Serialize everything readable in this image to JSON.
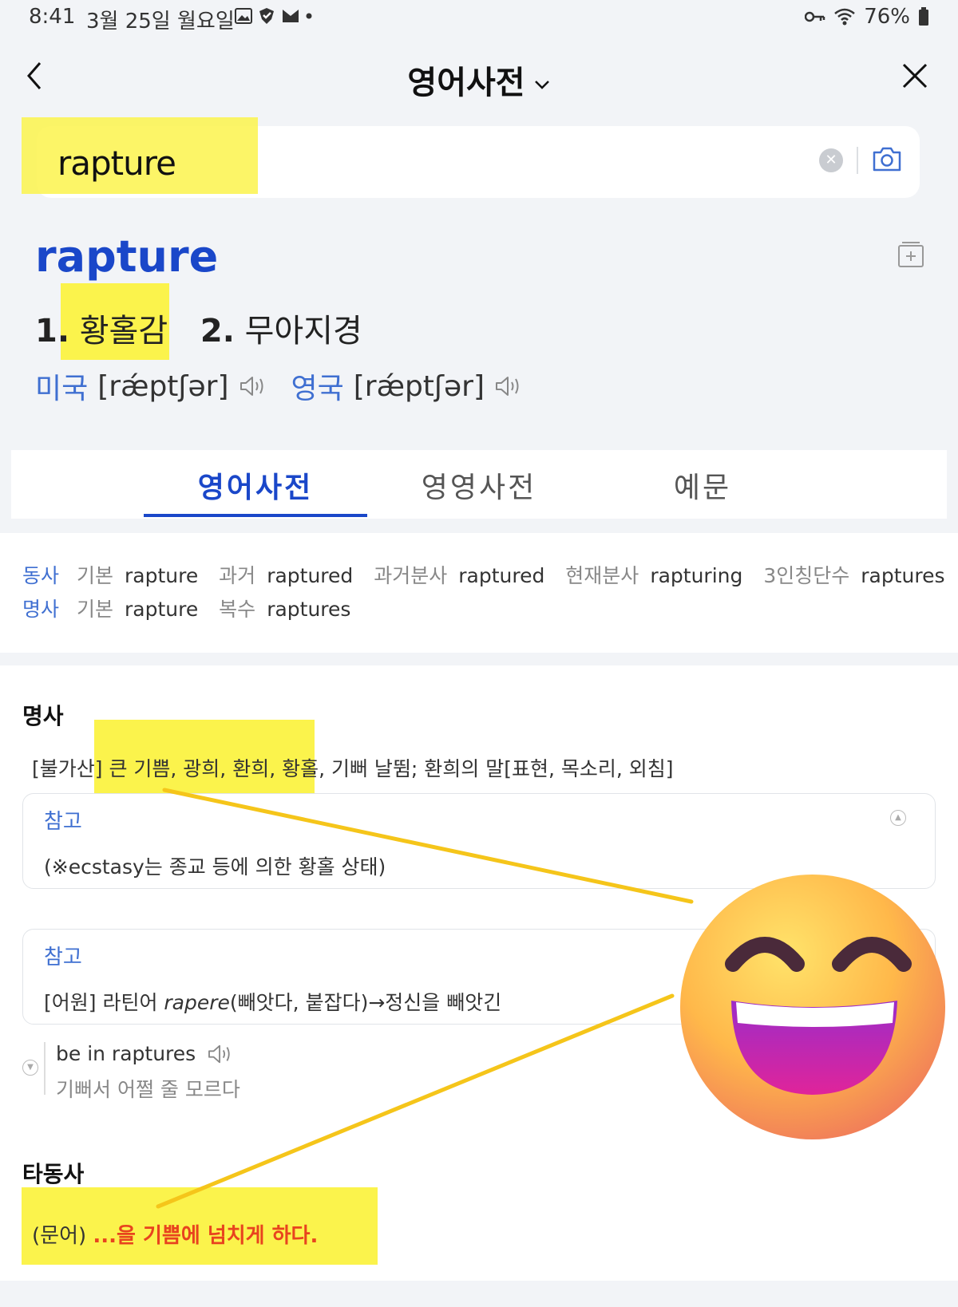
{
  "status": {
    "time": "8:41",
    "date": "3월 25일 월요일",
    "battery": "76%"
  },
  "header": {
    "title": "영어사전"
  },
  "search": {
    "query": "rapture"
  },
  "entry": {
    "headword": "rapture",
    "meaning1_num": "1.",
    "meaning1": "황홀감",
    "meaning2_num": "2.",
    "meaning2": "무아지경",
    "us_label": "미국",
    "us_ipa": "[rǽptʃər]",
    "uk_label": "영국",
    "uk_ipa": "[rǽptʃər]"
  },
  "tabs": {
    "t1": "영어사전",
    "t2": "영영사전",
    "t3": "예문"
  },
  "forms": {
    "verb": {
      "pos": "동사",
      "base_label": "기본",
      "base": "rapture",
      "past_label": "과거",
      "past": "raptured",
      "pp_label": "과거분사",
      "pp": "raptured",
      "ing_label": "현재분사",
      "ing": "rapturing",
      "s_label": "3인칭단수",
      "s": "raptures"
    },
    "noun": {
      "pos": "명사",
      "base_label": "기본",
      "base": "rapture",
      "pl_label": "복수",
      "pl": "raptures"
    }
  },
  "noun_section": {
    "title": "명사",
    "definition": "[불가산] 큰 기쁨, 광희, 환희, 황홀, 기뻐 날뜀; 환희의 말[표현, 목소리, 외침]",
    "note1_title": "참고",
    "note1_text": "(※ecstasy는 종교 등에 의한 황홀 상태)",
    "note2_title": "참고",
    "note2_pre": "[어원] 라틴어 ",
    "note2_italic": "rapere",
    "note2_post": "(빼앗다, 붙잡다)→정신을 빼앗긴",
    "idiom_en": "be in raptures",
    "idiom_ko": "기뻐서 어쩔 줄 모르다"
  },
  "verb_section": {
    "title": "타동사",
    "label": "(문어) ",
    "definition": "...을 기쁨에 넘치게 하다."
  },
  "colors": {
    "accent": "#1a47c9",
    "highlight": "#fbf34c",
    "red_text": "#e8431e",
    "annotation_line": "#f5c51a"
  }
}
